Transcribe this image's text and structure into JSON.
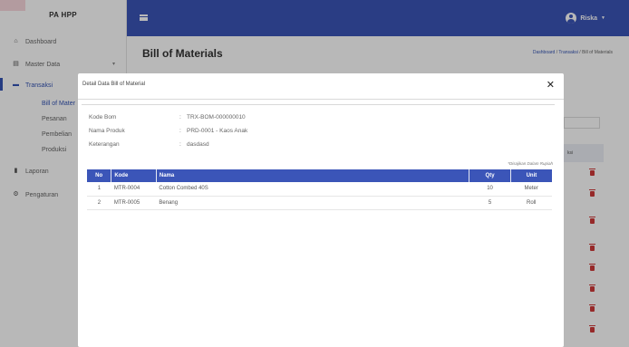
{
  "brand": "PA HPP",
  "sidebar": {
    "items": [
      {
        "label": "Dashboard",
        "icon": "home-icon"
      },
      {
        "label": "Master Data",
        "icon": "database-icon"
      },
      {
        "label": "Transaksi",
        "icon": "folder-icon"
      },
      {
        "label": "Laporan",
        "icon": "file-icon"
      },
      {
        "label": "Pengaturan",
        "icon": "cogs-icon"
      }
    ],
    "sub_items": [
      "Bill of Mater",
      "Pesanan",
      "Pembelian",
      "Produksi"
    ]
  },
  "topbar": {
    "user_name": "Riska"
  },
  "page": {
    "title": "Bill of Materials",
    "breadcrumb": [
      "Dashboard",
      "Transaksi",
      "Bill of Materials"
    ],
    "bg_header": "ksi"
  },
  "modal": {
    "title": "Detail Data Bill of Material",
    "close": "✕",
    "fields": [
      {
        "label": "Kode Bom",
        "value": "TRX-BOM-000000010"
      },
      {
        "label": "Nama Produk",
        "value": "PRD-0001 - Kaos Anak"
      },
      {
        "label": "Keterangan",
        "value": "dasdasd"
      }
    ],
    "note": "*Disajikan Dalam Rupiah",
    "table": {
      "headers": [
        "No",
        "Kode",
        "Nama",
        "Qty",
        "Unit"
      ],
      "rows": [
        [
          "1",
          "MTR-0004",
          "Cotton Combed 40S",
          "10",
          "Meter"
        ],
        [
          "2",
          "MTR-0005",
          "Benang",
          "5",
          "Roll"
        ]
      ]
    }
  },
  "colors": {
    "primary": "#3b55b8",
    "danger": "#d03a3a"
  }
}
